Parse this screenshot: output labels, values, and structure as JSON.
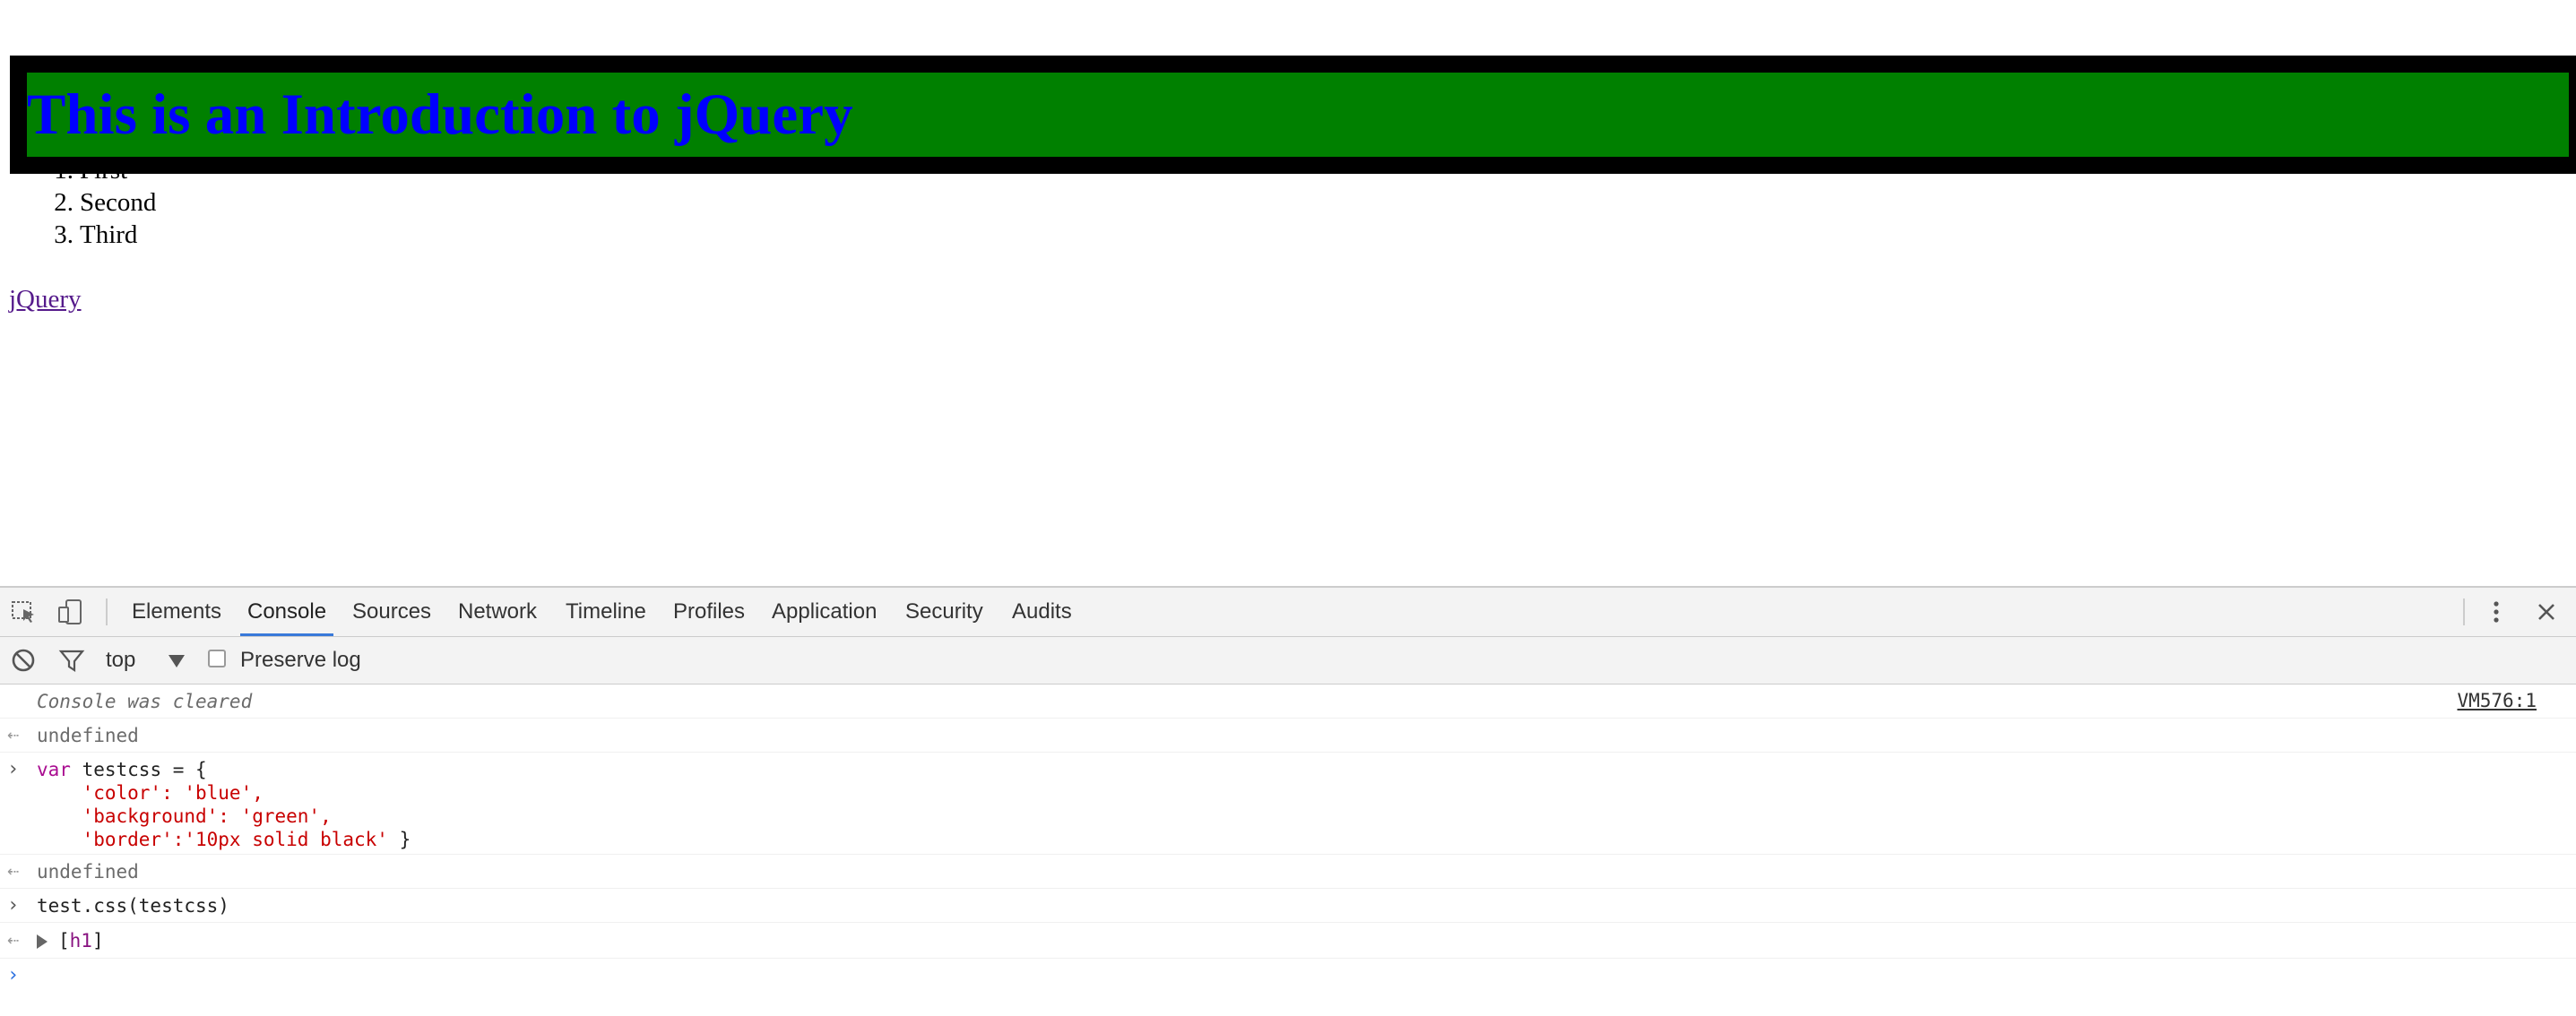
{
  "page": {
    "heading": "This is an Introduction to jQuery",
    "list": [
      {
        "num": "1.",
        "text": "First"
      },
      {
        "num": "2.",
        "text": "Second"
      },
      {
        "num": "3.",
        "text": "Third"
      }
    ],
    "link": "jQuery"
  },
  "devtools": {
    "tabs": [
      "Elements",
      "Console",
      "Sources",
      "Network",
      "Timeline",
      "Profiles",
      "Application",
      "Security",
      "Audits"
    ],
    "active_tab": "Console",
    "toolbar": {
      "context": "top",
      "preserve_log_label": "Preserve log",
      "preserve_log_checked": false
    },
    "console": {
      "cleared_message": "Console was cleared",
      "cleared_source": "VM576:1",
      "result1": "undefined",
      "input1": {
        "line1_kw": "var",
        "line1_rest": " testcss = {",
        "line2": "    'color': 'blue',",
        "line3": "    'background': 'green',",
        "line4_str": "    'border':'10px solid black'",
        "line4_rest": " }"
      },
      "result2": "undefined",
      "input2": "test.css(testcss)",
      "result3_open": "[",
      "result3_tag": "h1",
      "result3_close": "]"
    },
    "colors": {
      "heading_bg": "#008000",
      "heading_text": "#0000ff",
      "heading_border": "#000000",
      "active_tab_underline": "#3879d9",
      "keyword": "#aa0d91",
      "string": "#c80000"
    },
    "icons": [
      "inspect-element-icon",
      "device-mode-icon",
      "more-options-icon",
      "close-icon",
      "clear-console-icon",
      "filter-icon",
      "dropdown-arrow-icon"
    ]
  }
}
